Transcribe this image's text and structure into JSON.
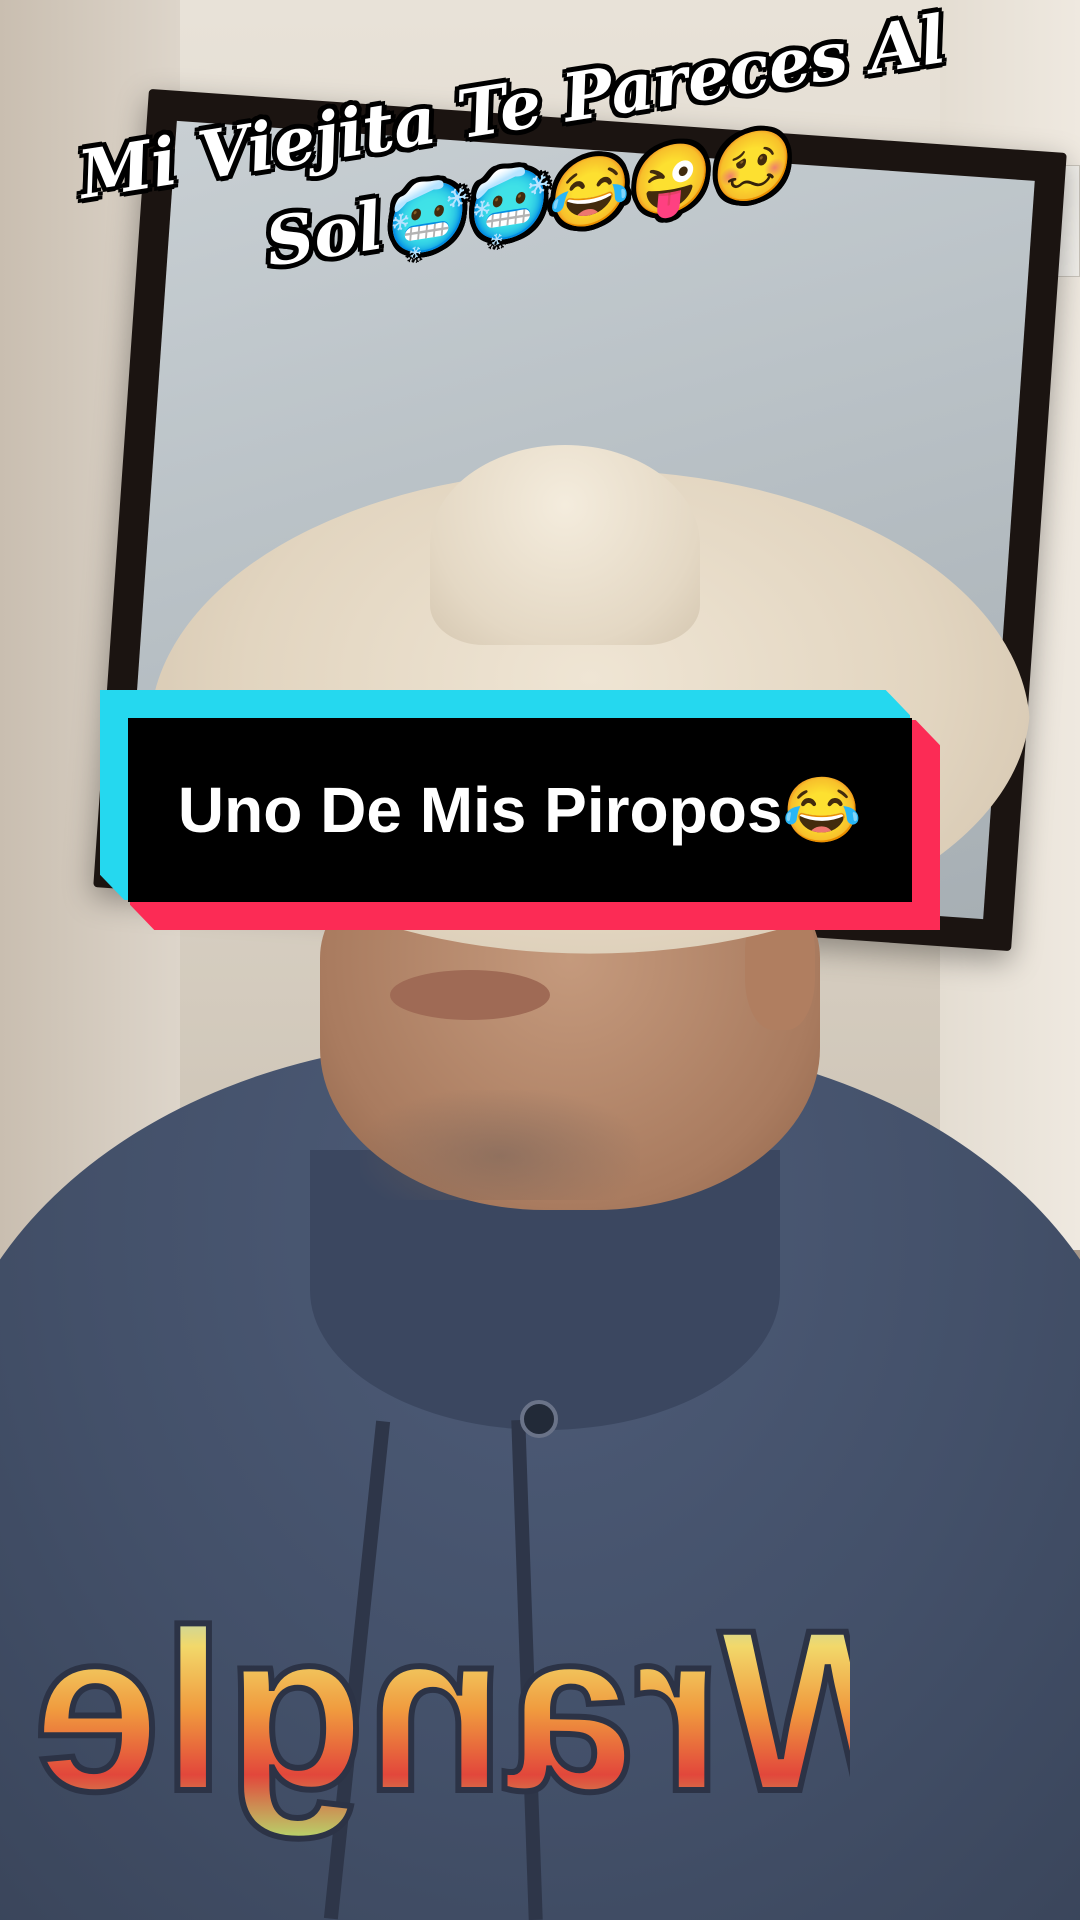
{
  "caption": {
    "line1": "Mi Viejita Te Pareces Al",
    "line2": "Sol🥶🥶😂😜🥴"
  },
  "banner": {
    "text": "Uno De Mis Piropos😂"
  },
  "hoodie_logo": {
    "text": "Wrangler"
  },
  "colors": {
    "banner_cyan": "#25d8ef",
    "banner_red": "#fc2b55",
    "banner_fill": "#000000",
    "hoodie": "#435069",
    "hat": "#e2d5c0",
    "mirror_frame": "#1b1411"
  }
}
